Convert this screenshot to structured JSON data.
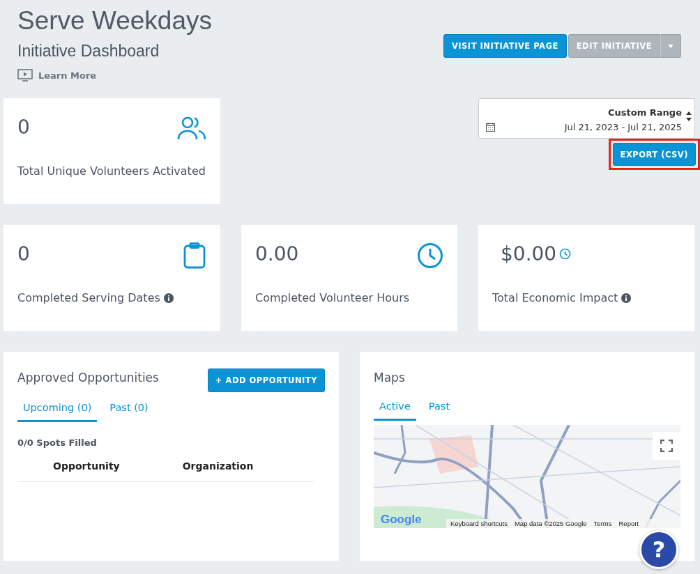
{
  "header": {
    "title": "Serve Weekdays",
    "subtitle": "Initiative Dashboard",
    "learn_more": "Learn More"
  },
  "actions": {
    "visit": "VISIT INITIATIVE PAGE",
    "edit": "EDIT INITIATIVE",
    "edit_disabled": true
  },
  "date_range": {
    "label": "Custom Range",
    "value": "Jul 21, 2023 - Jul 21, 2025"
  },
  "export": {
    "label": "EXPORT (CSV)",
    "highlighted": true
  },
  "stats": [
    {
      "kind": "people",
      "value": "0",
      "label": "Total Unique Volunteers Activated",
      "info": false
    },
    {
      "kind": "clipboard",
      "value": "0",
      "label": "Completed Serving Dates",
      "info": true
    },
    {
      "kind": "clock",
      "value": "0.00",
      "label": "Completed Volunteer Hours",
      "info": false
    },
    {
      "kind": "money",
      "value": "$0.00",
      "label": "Total Economic Impact",
      "info": true
    }
  ],
  "opportunities": {
    "title": "Approved Opportunities",
    "add_button": "+ ADD OPPORTUNITY",
    "tabs": [
      {
        "label": "Upcoming (0)",
        "selected": true
      },
      {
        "label": "Past (0)",
        "selected": false
      }
    ],
    "spots": "0/0 Spots Filled",
    "columns": [
      "Opportunity",
      "Organization"
    ]
  },
  "maps": {
    "title": "Maps",
    "tabs": [
      {
        "label": "Active",
        "selected": true
      },
      {
        "label": "Past",
        "selected": false
      }
    ],
    "logo": "Google",
    "attribution": [
      "Keyboard shortcuts",
      "Map data ©2025 Google",
      "Terms",
      "Report"
    ]
  },
  "help": "?"
}
